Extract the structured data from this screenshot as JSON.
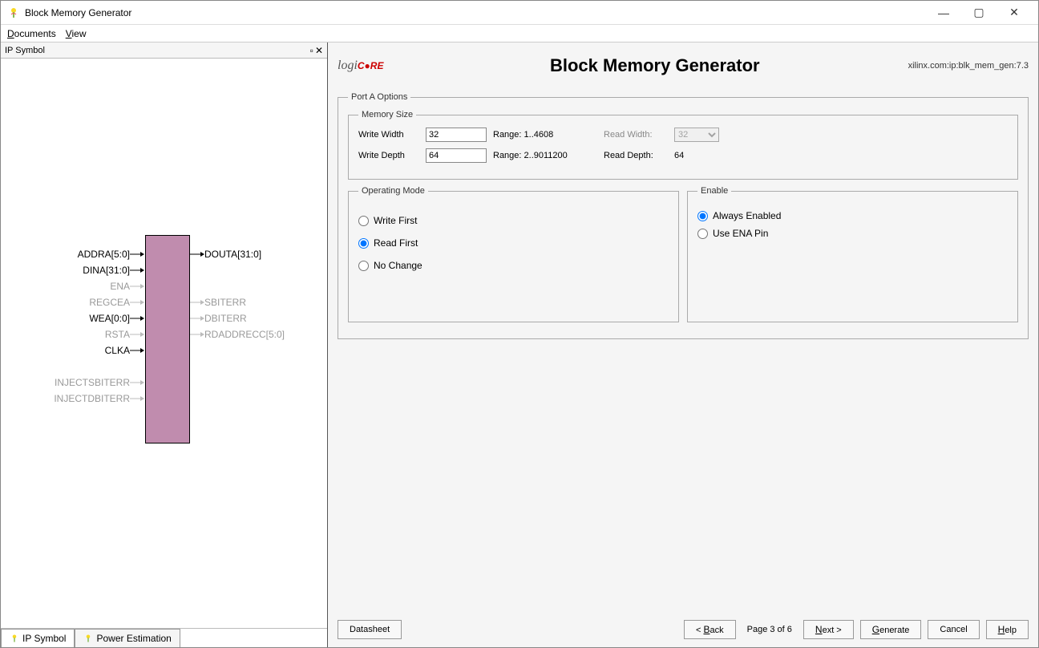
{
  "window": {
    "title": "Block Memory Generator"
  },
  "menu": {
    "documents": "Documents",
    "view": "View"
  },
  "leftPanel": {
    "title": "IP Symbol",
    "tabSymbol": "IP Symbol",
    "tabPower": "Power Estimation"
  },
  "ip": {
    "leftPorts": [
      {
        "label": "ADDRA[5:0]",
        "faded": false
      },
      {
        "label": "DINA[31:0]",
        "faded": false
      },
      {
        "label": "ENA",
        "faded": true
      },
      {
        "label": "REGCEA",
        "faded": true
      },
      {
        "label": "WEA[0:0]",
        "faded": false
      },
      {
        "label": "RSTA",
        "faded": true
      },
      {
        "label": "CLKA",
        "faded": false
      }
    ],
    "leftPorts2": [
      {
        "label": "INJECTSBITERR",
        "faded": true
      },
      {
        "label": "INJECTDBITERR",
        "faded": true
      }
    ],
    "rightPorts": [
      {
        "label": "DOUTA[31:0]",
        "faded": false
      },
      {
        "label": "",
        "faded": true
      },
      {
        "label": "",
        "faded": true
      },
      {
        "label": "SBITERR",
        "faded": true
      },
      {
        "label": "DBITERR",
        "faded": true
      },
      {
        "label": "RDADDRECC[5:0]",
        "faded": true
      }
    ]
  },
  "header": {
    "title": "Block Memory Generator",
    "vlnv": "xilinx.com:ip:blk_mem_gen:7.3"
  },
  "groupPortA": "Port A Options",
  "groupMem": "Memory Size",
  "mem": {
    "writeWidthLabel": "Write Width",
    "writeWidthValue": "32",
    "writeWidthRange": "Range: 1..4608",
    "readWidthLabel": "Read Width:",
    "readWidthValue": "32",
    "writeDepthLabel": "Write Depth",
    "writeDepthValue": "64",
    "writeDepthRange": "Range: 2..9011200",
    "readDepthLabel": "Read Depth:",
    "readDepthValue": "64"
  },
  "groupOp": "Operating Mode",
  "op": {
    "writeFirst": "Write First",
    "readFirst": "Read First",
    "noChange": "No Change"
  },
  "groupEn": "Enable",
  "en": {
    "always": "Always Enabled",
    "useEna": "Use ENA Pin"
  },
  "footer": {
    "datasheet": "Datasheet",
    "back": "< Back",
    "page": "Page 3 of 6",
    "next": "Next >",
    "generate": "Generate",
    "cancel": "Cancel",
    "help": "Help"
  }
}
